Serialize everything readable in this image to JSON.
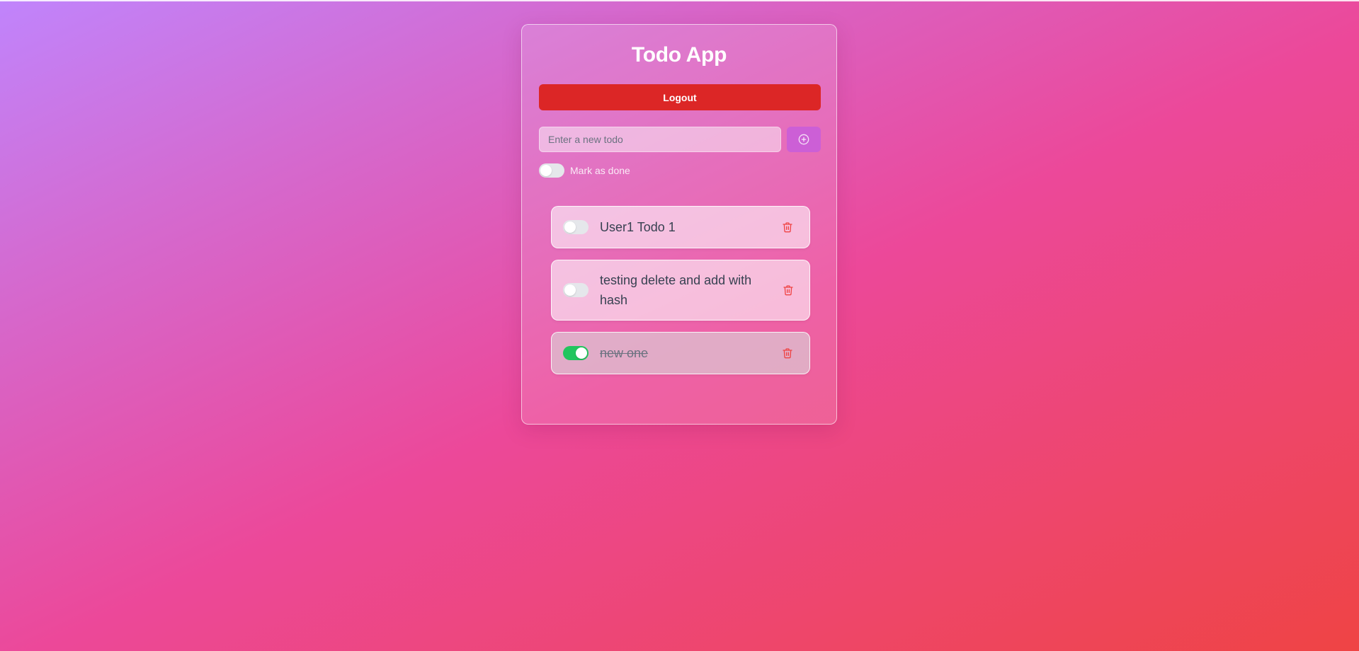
{
  "app": {
    "title": "Todo App"
  },
  "toolbar": {
    "logout_label": "Logout"
  },
  "new_todo": {
    "placeholder": "Enter a new todo",
    "value": "",
    "add_icon": "plus-circle-icon",
    "mark_done_label": "Mark as done",
    "mark_done_checked": false
  },
  "todos": [
    {
      "text": "User1 Todo 1",
      "done": false,
      "delete_icon": "trash-icon"
    },
    {
      "text": "testing delete and add with hash",
      "done": false,
      "delete_icon": "trash-icon"
    },
    {
      "text": "new one",
      "done": true,
      "delete_icon": "trash-icon"
    }
  ],
  "colors": {
    "logout": "#dc2626",
    "add_button": "#cc5fd6",
    "toggle_on": "#22c55e",
    "toggle_off": "#e5e7eb",
    "delete_icon": "#ef4444"
  }
}
